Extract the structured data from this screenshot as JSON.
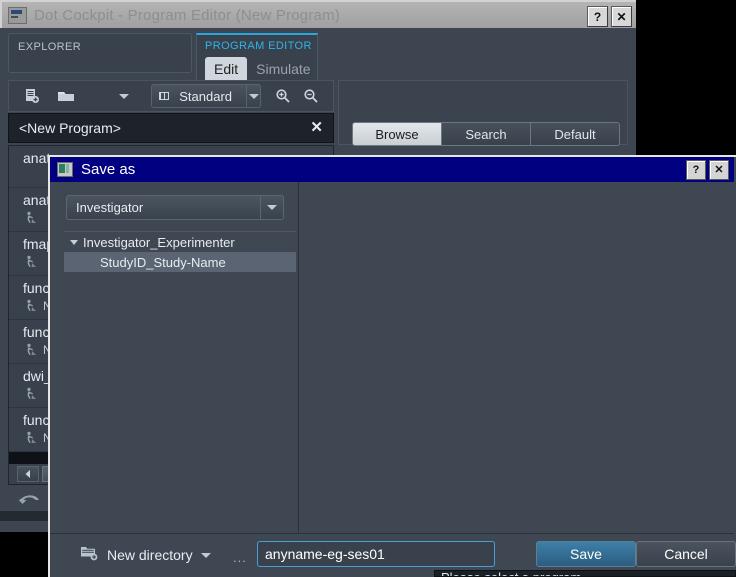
{
  "app": {
    "title": "Dot Cockpit - Program Editor (New Program)",
    "title_icon": "app-window-icon",
    "help_label": "?",
    "close_label": "✕"
  },
  "explorer": {
    "header": "EXPLORER",
    "toolbar": {
      "new_program_icon": "new-document-icon",
      "open_folder_icon": "open-folder-icon",
      "more_caret_icon": "chevron-down-icon",
      "protocol_label": "Standard",
      "protocol_icon": "ruler-icon",
      "protocol_caret_icon": "chevron-down-icon",
      "zoom_in_icon": "zoom-in-icon",
      "zoom_out_icon": "zoom-out-icon"
    },
    "program_tab": {
      "label": "<New Program>",
      "close_label": "✕"
    },
    "items": [
      {
        "name": "anat",
        "sub": ""
      },
      {
        "name": "anat",
        "sub": ""
      },
      {
        "name": "fmap",
        "sub": ""
      },
      {
        "name": "func_",
        "sub": "N"
      },
      {
        "name": "func_",
        "sub": "N"
      },
      {
        "name": "dwi_",
        "sub": ""
      },
      {
        "name": "func_",
        "sub": "N"
      }
    ],
    "scroll_left_icon": "scroll-left-arrow-icon",
    "undo_icon": "undo-arrow-icon"
  },
  "program_editor": {
    "header": "PROGRAM EDITOR",
    "tabs": [
      {
        "label": "Edit",
        "active": true
      },
      {
        "label": "Simulate",
        "active": false
      }
    ],
    "mode_buttons": [
      {
        "label": "Browse",
        "active": true
      },
      {
        "label": "Search",
        "active": false
      },
      {
        "label": "Default",
        "active": false
      }
    ]
  },
  "save_dialog": {
    "title": "Save as",
    "title_icon": "save-dialog-icon",
    "help_label": "?",
    "close_label": "✕",
    "scope_select": {
      "value": "Investigator",
      "caret_icon": "chevron-down-icon"
    },
    "tree": [
      {
        "label": "Investigator_Experimenter",
        "level": 0,
        "selected": false,
        "caret_icon": "triangle-down-icon"
      },
      {
        "label": "StudyID_Study-Name",
        "level": 1,
        "selected": true,
        "caret_icon": ""
      }
    ],
    "footer": {
      "new_directory_label": "New directory",
      "new_directory_icon": "new-folder-icon",
      "new_directory_caret_icon": "chevron-down-icon",
      "ellipsis": "...",
      "filename_value": "anyname-eg-ses01",
      "filename_placeholder": "anyname-eg-ses01",
      "save_label": "Save",
      "cancel_label": "Cancel"
    },
    "tooltip_text": "Please select a program"
  },
  "colors": {
    "window_chrome": "#a0a0a0",
    "panel_bg": "#3d4650",
    "dialog_titlebar": "#000080",
    "accent_cyan": "#2eb3ea",
    "accent_blue_button": "#3e7fa8",
    "input_focus_border": "#4a9fd4",
    "selection": "#5a6472"
  }
}
